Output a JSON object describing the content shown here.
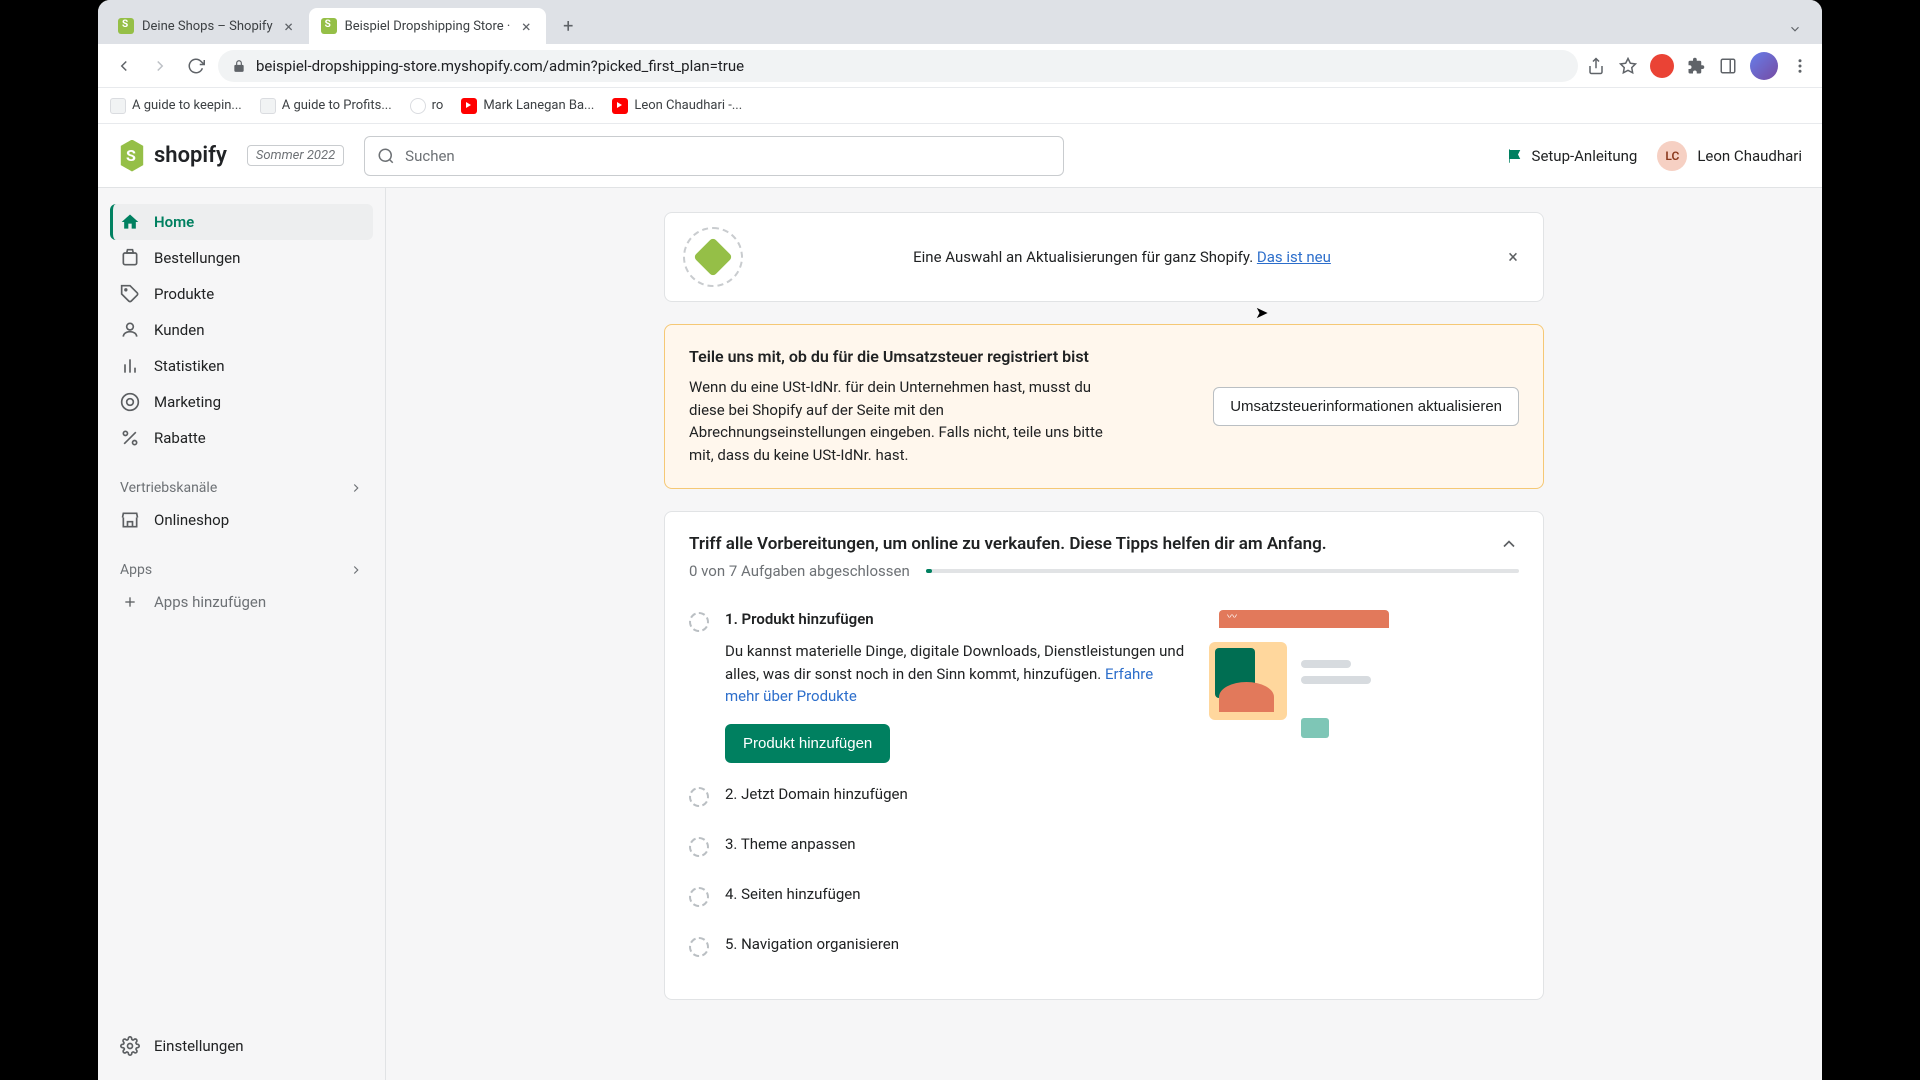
{
  "browser": {
    "tabs": [
      {
        "title": "Deine Shops – Shopify"
      },
      {
        "title": "Beispiel Dropshipping Store · "
      }
    ],
    "url": "beispiel-dropshipping-store.myshopify.com/admin?picked_first_plan=true",
    "bookmarks": [
      {
        "label": "A guide to keepin...",
        "icon": "doc"
      },
      {
        "label": "A guide to Profits...",
        "icon": "doc"
      },
      {
        "label": "ro",
        "icon": "ro"
      },
      {
        "label": "Mark Lanegan Ba...",
        "icon": "yt"
      },
      {
        "label": "Leon Chaudhari -...",
        "icon": "yt"
      }
    ]
  },
  "header": {
    "logo_text": "shopify",
    "edition": "Sommer 2022",
    "search_placeholder": "Suchen",
    "setup_link": "Setup-Anleitung",
    "user_initials": "LC",
    "user_name": "Leon Chaudhari"
  },
  "sidebar": {
    "nav": [
      {
        "label": "Home",
        "icon": "home",
        "active": true
      },
      {
        "label": "Bestellungen",
        "icon": "orders"
      },
      {
        "label": "Produkte",
        "icon": "products"
      },
      {
        "label": "Kunden",
        "icon": "customers"
      },
      {
        "label": "Statistiken",
        "icon": "analytics"
      },
      {
        "label": "Marketing",
        "icon": "marketing"
      },
      {
        "label": "Rabatte",
        "icon": "discounts"
      }
    ],
    "channels_label": "Vertriebskanäle",
    "channels": [
      {
        "label": "Onlineshop"
      }
    ],
    "apps_label": "Apps",
    "apps_add": "Apps hinzufügen",
    "settings": "Einstellungen"
  },
  "banner": {
    "text": "Eine Auswahl an Aktualisierungen für ganz Shopify. ",
    "link": "Das ist neu"
  },
  "tax_card": {
    "title": "Teile uns mit, ob du für die Umsatzsteuer registriert bist",
    "desc": "Wenn du eine USt-IdNr. für dein Unternehmen hast, musst du diese bei Shopify auf der Seite mit den Abrechnungseinstellungen eingeben. Falls nicht, teile uns bitte mit, dass du keine USt-IdNr. hast.",
    "button": "Umsatzsteuerinformationen aktualisieren"
  },
  "setup": {
    "title": "Triff alle Vorbereitungen, um online zu verkaufen. Diese Tipps helfen dir am Anfang.",
    "progress_text": "0 von 7 Aufgaben abgeschlossen",
    "tasks": [
      {
        "title": "1. Produkt hinzufügen",
        "desc": "Du kannst materielle Dinge, digitale Downloads, Dienstleistungen und alles, was dir sonst noch in den Sinn kommt, hinzufügen. ",
        "link": "Erfahre mehr über Produkte",
        "button": "Produkt hinzufügen",
        "expanded": true
      },
      {
        "title": "2. Jetzt Domain hinzufügen"
      },
      {
        "title": "3. Theme anpassen"
      },
      {
        "title": "4. Seiten hinzufügen"
      },
      {
        "title": "5. Navigation organisieren"
      }
    ]
  }
}
